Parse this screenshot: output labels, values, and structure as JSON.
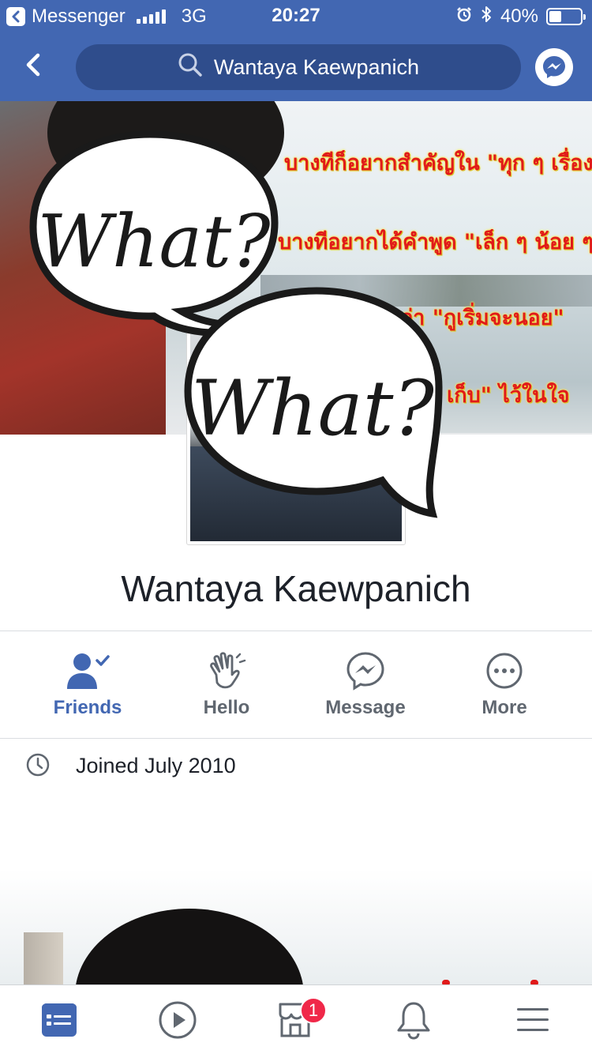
{
  "status_bar": {
    "back_app": "Messenger",
    "network": "3G",
    "time": "20:27",
    "battery_text": "40%",
    "battery_level": 0.4
  },
  "nav": {
    "search_text": "Wantaya Kaewpanich",
    "icons": [
      "back-icon",
      "search-icon",
      "messenger-icon"
    ]
  },
  "cover": {
    "lines": [
      "บางทีก็อยากสำคัญใน \"ทุก ๆ เรื่อง\"",
      "บางทีอยากได้คำพูด \"เล็ก ๆ น้อย ๆ\"",
      "ว่า \"กูเริ่มจะนอย\"",
      "เก็บ\" ไว้ในใจ"
    ],
    "bubble_text": "What?"
  },
  "profile": {
    "name": "Wantaya Kaewpanich"
  },
  "actions": [
    {
      "label": "Friends",
      "icon": "friends-check-icon",
      "active": true
    },
    {
      "label": "Hello",
      "icon": "wave-icon",
      "active": false
    },
    {
      "label": "Message",
      "icon": "messenger-icon",
      "active": false
    },
    {
      "label": "More",
      "icon": "more-dots-icon",
      "active": false
    }
  ],
  "info": {
    "joined": "Joined July 2010"
  },
  "tabbar": {
    "tabs": [
      "news-feed-icon",
      "watch-icon",
      "marketplace-icon",
      "notifications-icon",
      "menu-icon"
    ],
    "marketplace_badge": "1"
  },
  "colors": {
    "brand": "#4267b2",
    "search_bg": "#2f4d8c",
    "text_primary": "#1d2129",
    "text_secondary": "#606770",
    "badge": "#f02849",
    "cover_text": "#e01a1a"
  }
}
